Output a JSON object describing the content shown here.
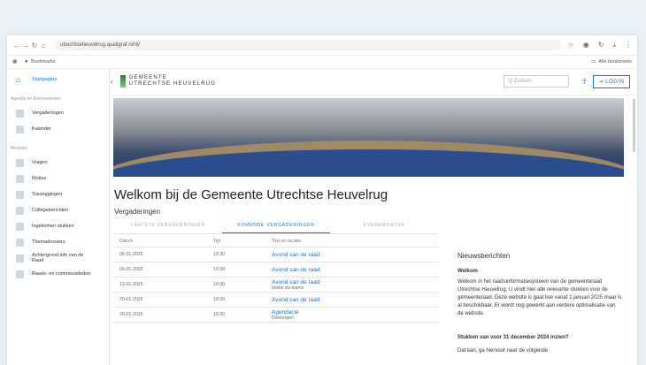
{
  "browser": {
    "url": "utrechtseheuvelrug.qualigraf.nl/nl/",
    "bookmarks_label": "Bookmarks",
    "all_bookmarks": "Alle bookmarks"
  },
  "sidebar": {
    "home": "Startpagina",
    "section1": "Agenda en Evenementen",
    "items1": [
      "Vergaderingen",
      "Kalender"
    ],
    "section2": "Modules",
    "items2": [
      "Vragen",
      "Moties",
      "Toezeggingen",
      "Collegeberichten",
      "Ingekomen stukken",
      "Themadossiers",
      "Achtergrond info van de Raad",
      "Raads- en commissieleden"
    ]
  },
  "header": {
    "logo_line1": "GEMEENTE",
    "logo_line2": "UTRECHTSE HEUVELRUG",
    "search_placeholder": "Q Zoeken",
    "login": "⇥ LOGIN"
  },
  "main": {
    "title": "Welkom bij de Gemeente Utrechtse Heuvelrug",
    "section": "Vergaderingen",
    "tabs": [
      "LAATSTE VERGADERINGEN",
      "KOMENDE VERGADERINGEN",
      "EVENEMENTEN"
    ],
    "columns": [
      "Datum",
      "Tijd",
      "Titel en locatie"
    ],
    "rows": [
      {
        "date": "06-01-2025",
        "time": "19:30",
        "title": "Avond van de raad",
        "sub": ""
      },
      {
        "date": "09-01-2025",
        "time": "19:30",
        "title": "Avond van de raad",
        "sub": ""
      },
      {
        "date": "13-01-2025",
        "time": "19:30",
        "title": "Avond van de raad",
        "sub": "online via teams"
      },
      {
        "date": "20-01-2025",
        "time": "19:30",
        "title": "Avond van de raad",
        "sub": ""
      },
      {
        "date": "20-01-2025",
        "time": "19:30",
        "title": "Agendacie",
        "sub": "Driebergen"
      }
    ]
  },
  "news": {
    "title": "Nieuwsberichten",
    "item1_title": "Welkom",
    "item1_body": "Welkom in het raadsinformatiesysteem van de gemeenteraad Utrechtse Heuvelrug. U vindt hier alle relevante stukken voor de gemeenteraad. Deze website is gaat live vanaf 1 januari 2025 maar is al beschikbaar. Er wordt nog gewerkt aan verdere optimalisatie van de website.",
    "item2_title": "Stukken van voor 31 december 2024 inzien?",
    "item2_body": "Dat kan, ga hiervoor naar de volgende"
  }
}
